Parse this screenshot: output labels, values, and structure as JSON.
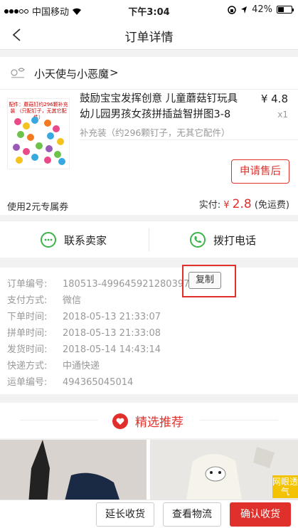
{
  "status": {
    "carrier": "中国移动",
    "time": "下午3:04",
    "battery": "42%"
  },
  "nav": {
    "title": "订单详情"
  },
  "shop": {
    "name": "小天使与小恶魔",
    "arrow": ">"
  },
  "product": {
    "image_caption": "配件：蘑菇钉约296颗补充装 （只配钉子，无其它配件）",
    "title": "鼓励宝宝发挥创意 儿童蘑菇钉玩具幼儿园男孩女孩拼插益智拼图3-8",
    "price": "¥ 4.8",
    "quantity": "x1",
    "spec": "补充装（约296颗钉子，无其它配件）",
    "after_sale_button": "申请售后"
  },
  "coupon": {
    "label": "使用2元专属券",
    "paid_prefix": "实付:",
    "currency": "¥",
    "amount": "2.8",
    "shipping_note": "(免运费)"
  },
  "contact": {
    "seller": "联系卖家",
    "phone": "拨打电话"
  },
  "order_info": {
    "order_no_label": "订单编号:",
    "order_no": "180513-499645921280397",
    "copy_button": "复制",
    "pay_label": "支付方式:",
    "pay": "微信",
    "order_time_label": "下单时间:",
    "order_time": "2018-05-13 21:33:07",
    "group_time_label": "拼单时间:",
    "group_time": "2018-05-13 21:33:08",
    "ship_time_label": "发货时间:",
    "ship_time": "2018-05-14 14:43:14",
    "express_label": "快递方式:",
    "express": "中通快递",
    "tracking_label": "运单编号:",
    "tracking": "494365045014"
  },
  "recommend": {
    "label": "精选推荐"
  },
  "photos": {
    "tag": "网眼透气"
  },
  "bottom": {
    "extend": "延长收货",
    "logistics": "查看物流",
    "confirm": "确认收货"
  },
  "colors": {
    "accent": "#e0302b",
    "green": "#3cb44a"
  }
}
